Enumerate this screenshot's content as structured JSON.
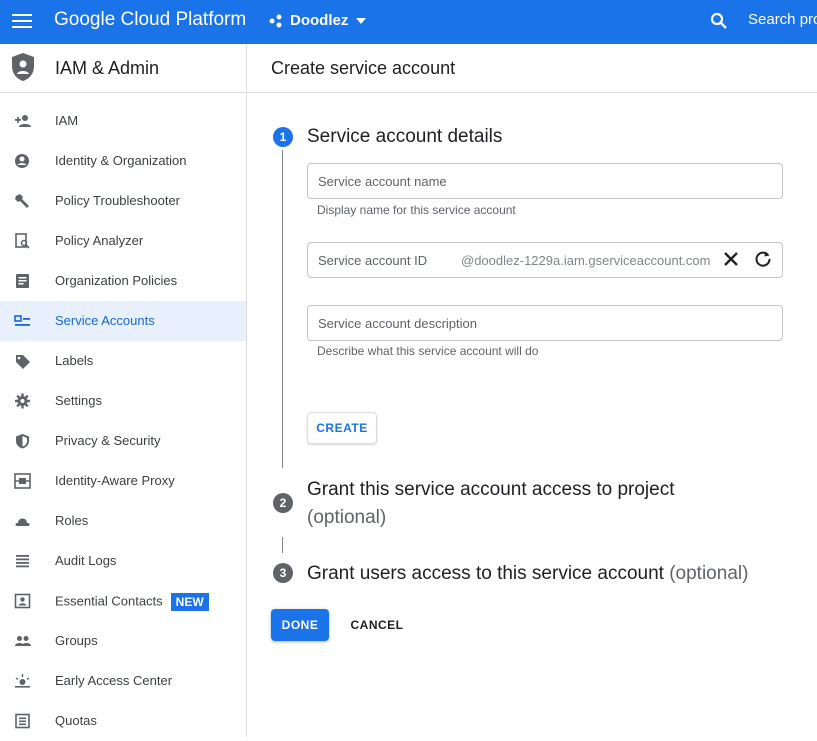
{
  "topbar": {
    "brand": "Google Cloud Platform",
    "project": "Doodlez",
    "search_text": "Search pro"
  },
  "sidebar": {
    "title": "IAM & Admin",
    "items": [
      {
        "label": "IAM",
        "icon": "person-add-icon"
      },
      {
        "label": "Identity & Organization",
        "icon": "account-circle-icon"
      },
      {
        "label": "Policy Troubleshooter",
        "icon": "wrench-icon"
      },
      {
        "label": "Policy Analyzer",
        "icon": "document-search-icon"
      },
      {
        "label": "Organization Policies",
        "icon": "list-document-icon"
      },
      {
        "label": "Service Accounts",
        "icon": "service-account-icon",
        "active": true
      },
      {
        "label": "Labels",
        "icon": "tag-icon"
      },
      {
        "label": "Settings",
        "icon": "gear-icon"
      },
      {
        "label": "Privacy & Security",
        "icon": "shield-icon"
      },
      {
        "label": "Identity-Aware Proxy",
        "icon": "proxy-icon"
      },
      {
        "label": "Roles",
        "icon": "hat-icon"
      },
      {
        "label": "Audit Logs",
        "icon": "lines-icon"
      },
      {
        "label": "Essential Contacts",
        "icon": "contact-card-icon",
        "badge": "NEW"
      },
      {
        "label": "Groups",
        "icon": "people-icon"
      },
      {
        "label": "Early Access Center",
        "icon": "sparkle-icon"
      },
      {
        "label": "Quotas",
        "icon": "quota-icon"
      }
    ]
  },
  "main": {
    "title": "Create service account",
    "steps": [
      {
        "number": "1",
        "title": "Service account details",
        "optional": ""
      },
      {
        "number": "2",
        "title": "Grant this service account access to project",
        "optional": "(optional)"
      },
      {
        "number": "3",
        "title": "Grant users access to this service account",
        "optional": "(optional)"
      }
    ],
    "fields": {
      "name_placeholder": "Service account name",
      "name_helper": "Display name for this service account",
      "id_placeholder": "Service account ID",
      "id_suffix": "@doodlez-1229a.iam.gserviceaccount.com",
      "description_placeholder": "Service account description",
      "description_helper": "Describe what this service account will do"
    },
    "buttons": {
      "create": "CREATE",
      "done": "DONE",
      "cancel": "CANCEL"
    }
  },
  "colors": {
    "brand_blue": "#1a73e8",
    "active_bg": "#e8f0fe",
    "active_text": "#1967d2",
    "step_inactive": "#5f6368"
  }
}
